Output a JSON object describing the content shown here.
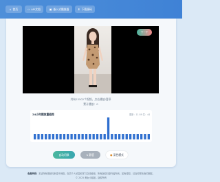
{
  "nav": {
    "items": [
      {
        "label": "首页",
        "icon": "home-icon"
      },
      {
        "label": "API文档",
        "icon": "code-icon"
      },
      {
        "label": "嵌入式播放器",
        "icon": "embed-icon"
      },
      {
        "label": "下载源码",
        "icon": "download-icon"
      }
    ]
  },
  "player": {
    "next_label": "下一个"
  },
  "info": {
    "source_line": "共有23502个视频，点击播放/暂停",
    "counter_line": "累计播放：0"
  },
  "stats": {
    "title": "24小时播放量趋势",
    "meta": "更新：11:59  共：44",
    "bars": [
      1,
      1,
      1,
      1,
      1,
      1,
      1,
      1,
      1,
      1,
      1,
      1,
      1,
      1,
      1,
      1,
      1,
      1,
      1,
      1,
      4,
      1,
      1,
      1,
      1,
      1,
      1,
      1,
      1,
      1,
      1,
      1
    ],
    "bar_color": "#2f6fcf"
  },
  "actions": {
    "auto_label": "自动切换",
    "mute_label": "静音",
    "dark_label": "深色模式"
  },
  "footer": {
    "disclaimer_label": "免责声明：",
    "disclaimer_text": "本站所有视频均来源于网络，仅供个人欣赏和学习交流使用，所有版权归原作者所有。如有侵权，请及时联系我们删除。",
    "copyright": "© 2025 美女小姐姐 - 版权所有"
  },
  "colors": {
    "header": "#4e8fd9",
    "accent_green": "#4bb79e",
    "background": "#dbe9f6"
  }
}
